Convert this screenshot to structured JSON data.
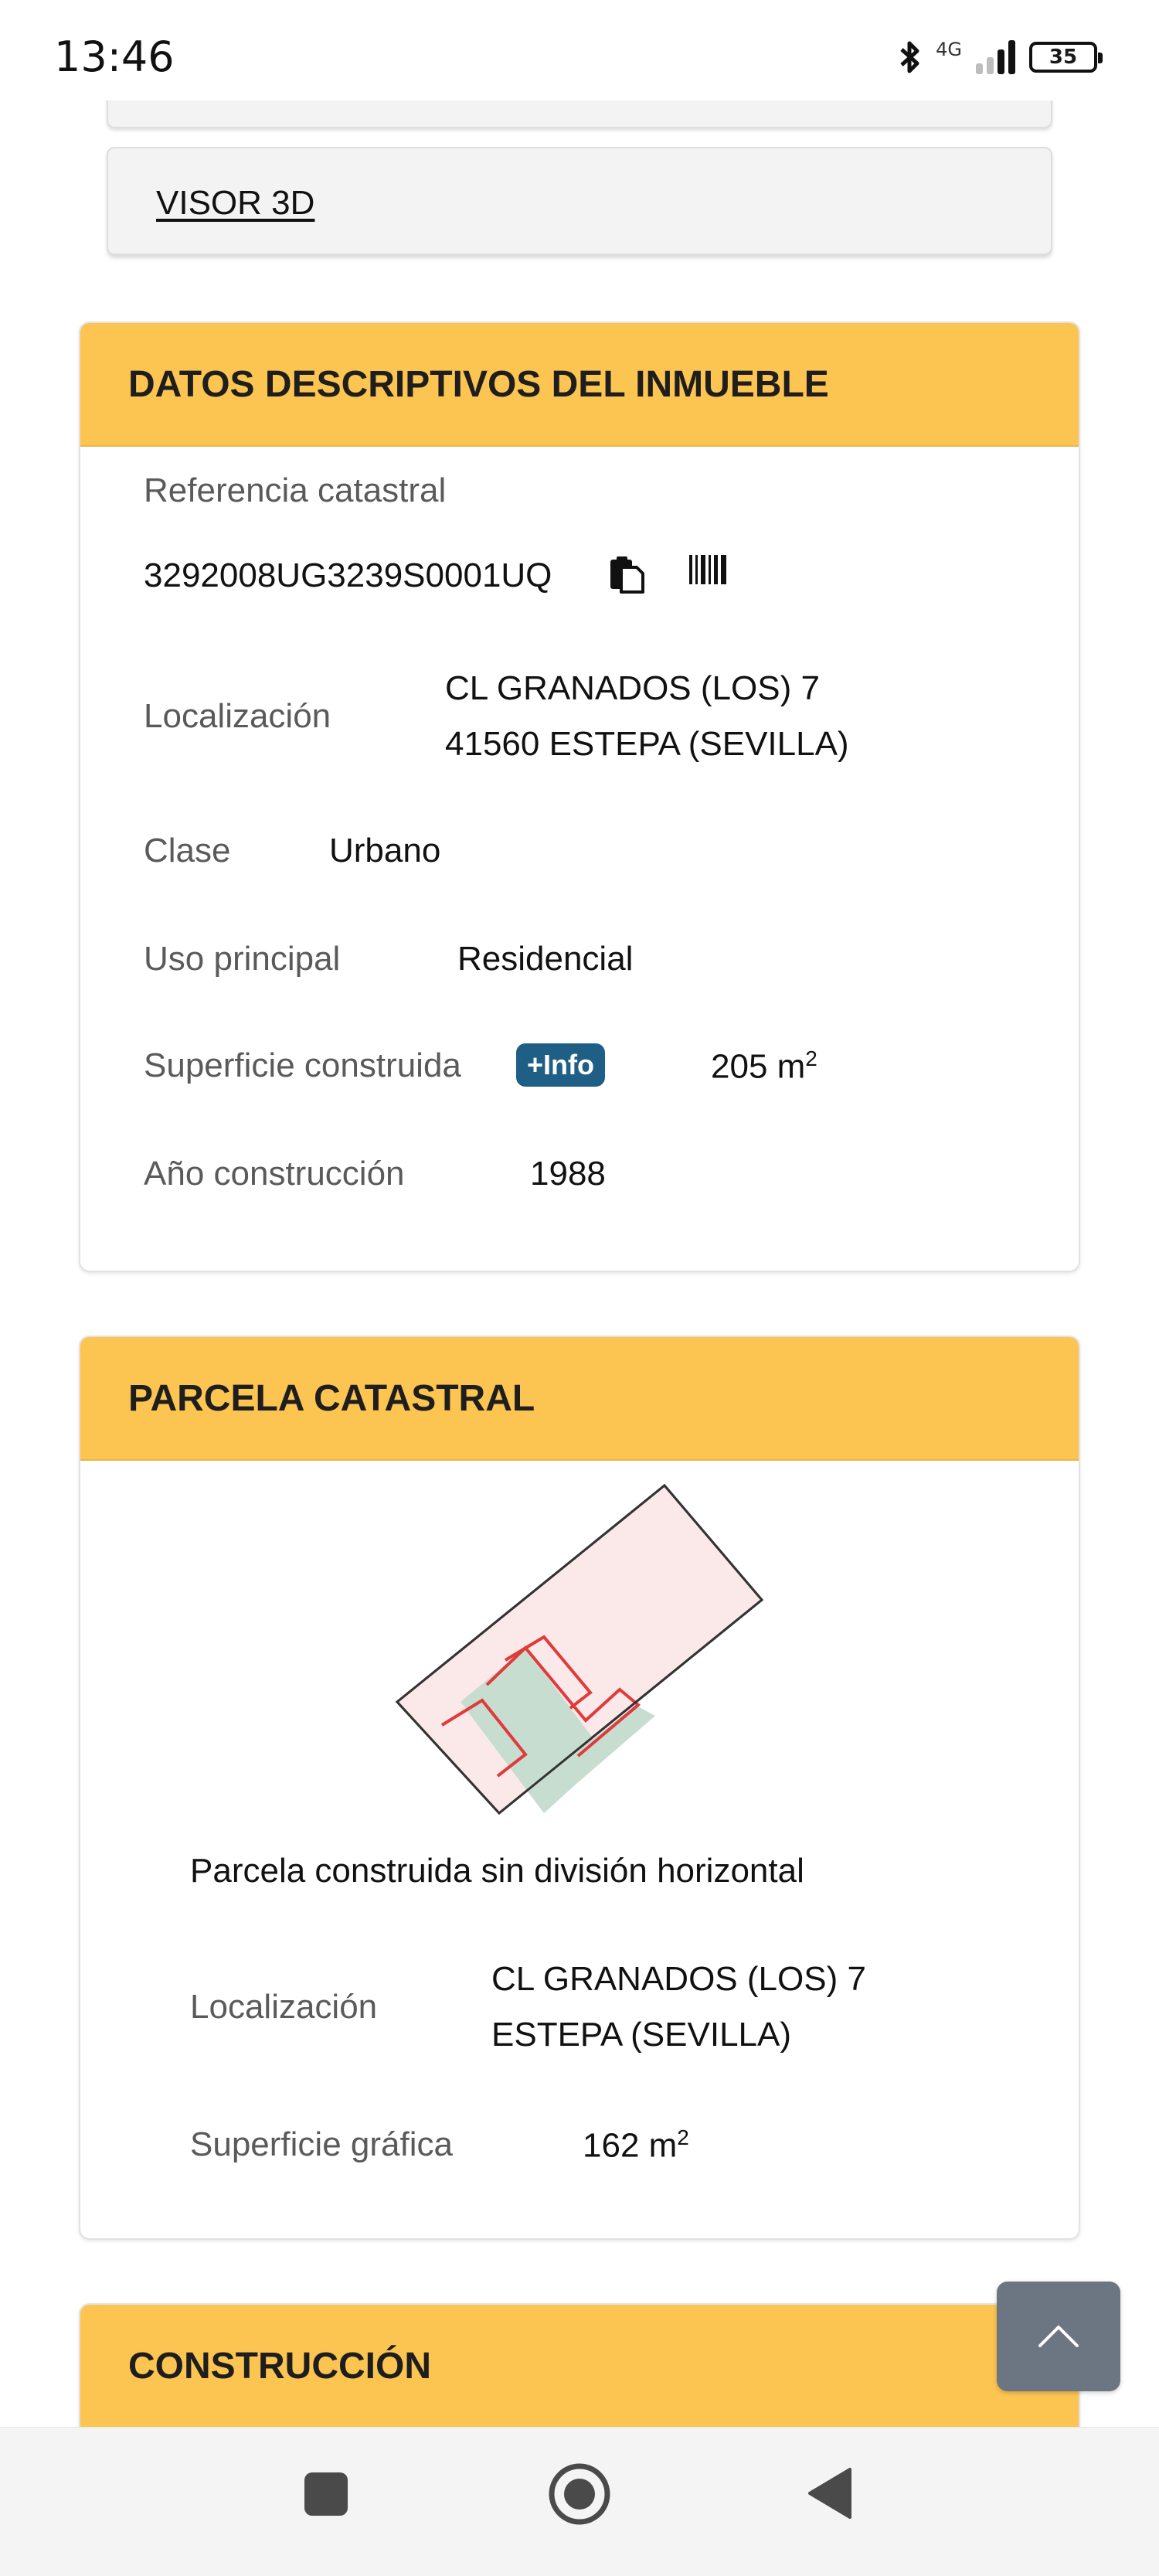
{
  "status_bar": {
    "time": "13:46",
    "network": "4G",
    "battery": "35",
    "icons": [
      "bluetooth-icon",
      "signal-icon",
      "battery-icon"
    ]
  },
  "top_panels": {
    "visor_link": "VISOR 3D"
  },
  "datos": {
    "header": "DATOS DESCRIPTIVOS DEL INMUEBLE",
    "referencia_label": "Referencia catastral",
    "referencia_value": "3292008UG3239S0001UQ",
    "localizacion_label": "Localización",
    "localizacion_line1": "CL GRANADOS (LOS) 7",
    "localizacion_line2": "41560 ESTEPA (SEVILLA)",
    "clase_label": "Clase",
    "clase_value": "Urbano",
    "uso_label": "Uso principal",
    "uso_value": "Residencial",
    "superficie_label": "Superficie construida",
    "info_badge": "+Info",
    "superficie_value": "205 m",
    "superficie_unit_exp": "2",
    "ano_label": "Año construcción",
    "ano_value": "1988"
  },
  "parcela": {
    "header": "PARCELA CATASTRAL",
    "descripcion": "Parcela construida sin división horizontal",
    "localizacion_label": "Localización",
    "localizacion_line1": "CL GRANADOS (LOS) 7",
    "localizacion_line2": "ESTEPA (SEVILLA)",
    "superficie_label": "Superficie gráfica",
    "superficie_value": "162 m",
    "superficie_unit_exp": "2"
  },
  "construccion": {
    "header": "CONSTRUCCIÓN"
  },
  "colors": {
    "header_bg": "#fcc451",
    "info_badge_bg": "#1f5f86",
    "parcel_fill": "#fbe9e9",
    "parcel_green": "#c7ddd0",
    "parcel_red_line": "#e03a3a",
    "scroll_top_bg": "#6c7582"
  },
  "navigation": {
    "buttons": [
      "recents-button",
      "home-button",
      "back-button"
    ]
  }
}
